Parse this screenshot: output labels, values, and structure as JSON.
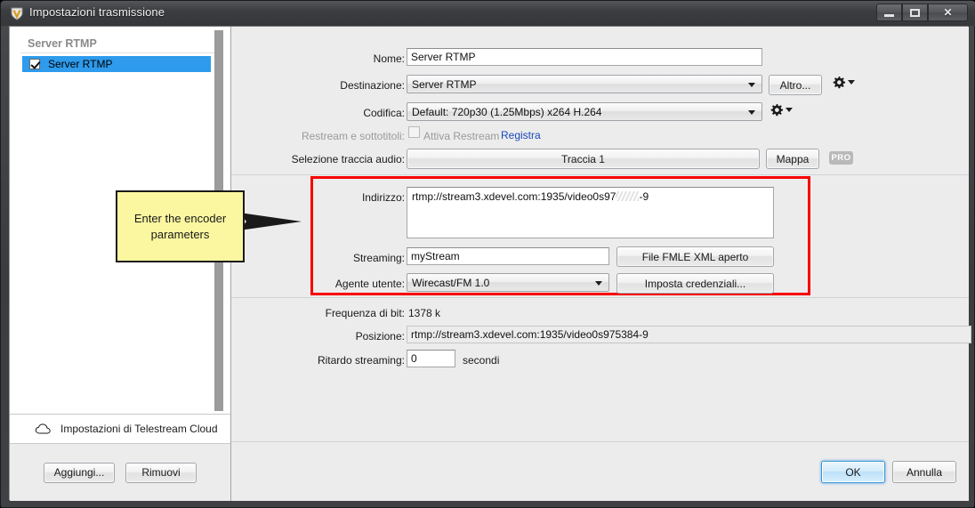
{
  "window": {
    "title": "Impostazioni trasmissione",
    "icon": "wirecast-shield-icon",
    "controls": {
      "minimize": "–",
      "maximize": "□",
      "close": "✕"
    }
  },
  "sidebar": {
    "group_header": "Server RTMP",
    "item": {
      "label": "Server RTMP",
      "checked": true,
      "selected": true
    },
    "cloud_row": {
      "icon": "cloud-icon",
      "label": "Impostazioni di Telestream Cloud"
    },
    "buttons": {
      "add": "Aggiungi...",
      "remove": "Rimuovi"
    }
  },
  "form": {
    "name": {
      "label": "Nome:",
      "value": "Server RTMP"
    },
    "destination": {
      "label": "Destinazione:",
      "value": "Server RTMP",
      "more_button": "Altro...",
      "gear": "gear-icon"
    },
    "encoding": {
      "label": "Codifica:",
      "value": "Default: 720p30 (1.25Mbps) x264 H.264",
      "gear": "gear-icon"
    },
    "restream": {
      "label": "Restream e sottotitoli:",
      "checkbox_label": "Attiva Restream",
      "checked": false,
      "link": "Registra"
    },
    "audio_track": {
      "label": "Selezione traccia audio:",
      "value": "Traccia 1",
      "map_button": "Mappa",
      "badge": "PRO"
    },
    "address": {
      "label": "Indirizzo:",
      "value_prefix": "rtmp://stream3.xdevel.com:1935/video0s97",
      "value_suffix": "-9",
      "redacted": true
    },
    "stream": {
      "label": "Streaming:",
      "value": "myStream",
      "button": "File FMLE XML aperto"
    },
    "user_agent": {
      "label": "Agente utente:",
      "value": "Wirecast/FM 1.0",
      "button": "Imposta credenziali..."
    },
    "bitrate": {
      "label": "Frequenza di bit:",
      "value": "1378 k"
    },
    "position": {
      "label": "Posizione:",
      "value": "rtmp://stream3.xdevel.com:1935/video0s975384-9"
    },
    "stream_delay": {
      "label": "Ritardo streaming:",
      "value": "0",
      "unit": "secondi"
    }
  },
  "annotation": {
    "callout_text": "Enter the encoder parameters",
    "highlight_color": "#f80000",
    "callout_bg": "#fbf7a0"
  },
  "footer": {
    "ok": "OK",
    "cancel": "Annulla"
  }
}
